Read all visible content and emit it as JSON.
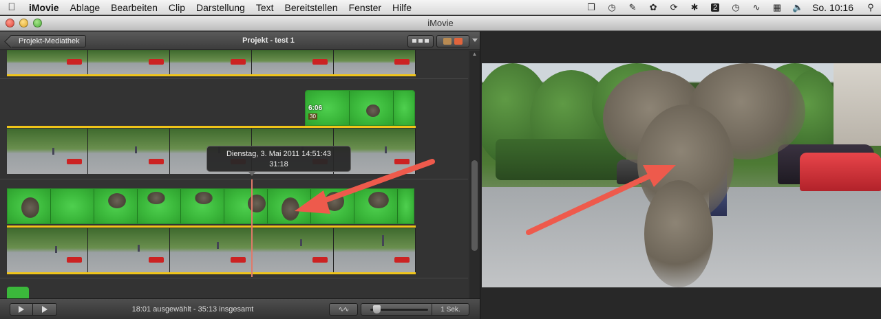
{
  "menubar": {
    "apple_icon": "apple-icon",
    "items": [
      "iMovie",
      "Ablage",
      "Bearbeiten",
      "Clip",
      "Darstellung",
      "Text",
      "Bereitstellen",
      "Fenster",
      "Hilfe"
    ],
    "clock": "So. 10:16",
    "status_badge": "2"
  },
  "window": {
    "title": "iMovie"
  },
  "project": {
    "back_label": "Projekt-Mediathek",
    "title": "Projekt - test 1",
    "green_clip": {
      "duration": "6:06",
      "fps_badge": "30"
    },
    "tooltip": {
      "date": "Dienstag, 3. Mai 2011 14:51:43",
      "time": "31:18"
    }
  },
  "bottombar": {
    "status": "18:01 ausgewählt - 35:13 insgesamt",
    "zoom_label": "1 Sek."
  },
  "colors": {
    "accent_yellow": "#f0c419",
    "green_screen": "#3bb83b",
    "arrow_red": "#ee5a4c",
    "playhead": "#e07a6a"
  }
}
